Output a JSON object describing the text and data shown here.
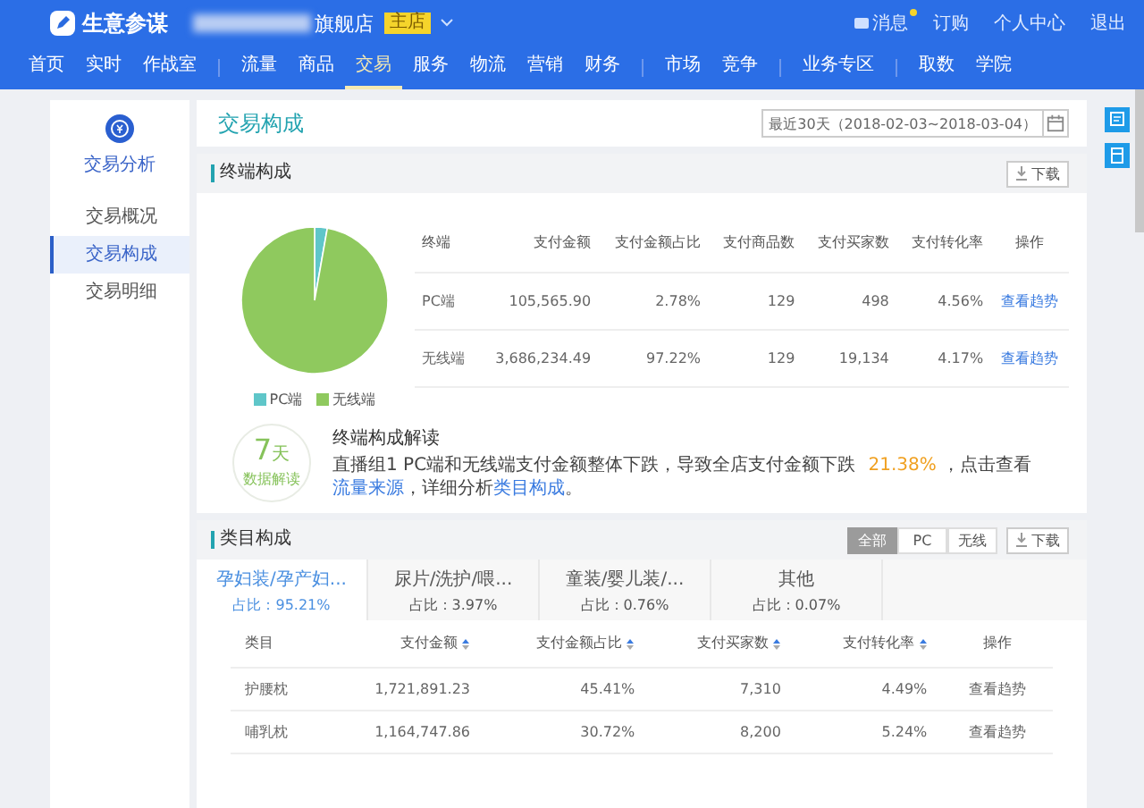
{
  "header": {
    "logo_text": "生意参谋",
    "store_suffix": "旗舰店",
    "badge": "主店",
    "links": [
      {
        "label": "消息",
        "dot": true
      },
      {
        "label": "订购",
        "dot": false
      },
      {
        "label": "个人中心",
        "dot": false
      },
      {
        "label": "退出",
        "dot": false
      }
    ],
    "nav_groups": [
      [
        {
          "label": "首页",
          "selected": false
        },
        {
          "label": "实时",
          "selected": false
        },
        {
          "label": "作战室",
          "selected": false
        }
      ],
      [
        {
          "label": "流量",
          "selected": false
        },
        {
          "label": "商品",
          "selected": false
        },
        {
          "label": "交易",
          "selected": true
        },
        {
          "label": "服务",
          "selected": false
        },
        {
          "label": "物流",
          "selected": false
        },
        {
          "label": "营销",
          "selected": false
        },
        {
          "label": "财务",
          "selected": false
        }
      ],
      [
        {
          "label": "市场",
          "selected": false
        },
        {
          "label": "竞争",
          "selected": false
        }
      ],
      [
        {
          "label": "业务专区",
          "selected": false
        }
      ],
      [
        {
          "label": "取数",
          "selected": false
        },
        {
          "label": "学院",
          "selected": false
        }
      ]
    ]
  },
  "sidebar": {
    "title": "交易分析",
    "items": [
      {
        "label": "交易概况",
        "selected": false
      },
      {
        "label": "交易构成",
        "selected": true
      },
      {
        "label": "交易明细",
        "selected": false
      }
    ]
  },
  "page": {
    "title": "交易构成",
    "date_range": "最近30天（2018-02-03~2018-03-04）"
  },
  "terminal": {
    "title": "终端构成",
    "download": "下载",
    "chart_data": {
      "type": "pie",
      "categories": [
        "PC端",
        "无线端"
      ],
      "values": [
        2.78,
        97.22
      ],
      "legend": "bottom"
    },
    "columns": [
      "终端",
      "支付金额",
      "支付金额占比",
      "支付商品数",
      "支付买家数",
      "支付转化率",
      "操作"
    ],
    "rows": [
      [
        "PC端",
        "105,565.90",
        "2.78%",
        "129",
        "498",
        "4.56%",
        "查看趋势"
      ],
      [
        "无线端",
        "3,686,234.49",
        "97.22%",
        "129",
        "19,134",
        "4.17%",
        "查看趋势"
      ]
    ],
    "insight": {
      "badge_number": "7",
      "badge_unit": "天",
      "badge_label": "数据解读",
      "title": "终端构成解读",
      "segments": [
        {
          "kind": "text",
          "text": "直播组1 PC端和无线端支付金额整体下跌，导致全店支付金额下跌 "
        },
        {
          "kind": "highlight",
          "text": "21.38%"
        },
        {
          "kind": "text",
          "text": " ，点击查看"
        },
        {
          "kind": "link",
          "text": "流量来源"
        },
        {
          "kind": "text",
          "text": "，详细分析"
        },
        {
          "kind": "link",
          "text": "类目构成"
        },
        {
          "kind": "text",
          "text": "。"
        }
      ]
    }
  },
  "category": {
    "title": "类目构成",
    "download": "下载",
    "filters": [
      {
        "label": "全部",
        "selected": true
      },
      {
        "label": "PC",
        "selected": false
      },
      {
        "label": "无线",
        "selected": false
      }
    ],
    "tabs": [
      {
        "label": "孕妇装/孕产妇...",
        "share": "占比：95.21%",
        "selected": true
      },
      {
        "label": "尿片/洗护/喂...",
        "share": "占比：3.97%",
        "selected": false
      },
      {
        "label": "童装/婴儿装/...",
        "share": "占比：0.76%",
        "selected": false
      },
      {
        "label": "其他",
        "share": "占比：0.07%",
        "selected": false
      }
    ],
    "columns": [
      {
        "label": "类目",
        "sortable": false
      },
      {
        "label": "支付金额",
        "sortable": true
      },
      {
        "label": "支付金额占比",
        "sortable": true
      },
      {
        "label": "支付买家数",
        "sortable": true
      },
      {
        "label": "支付转化率",
        "sortable": true
      },
      {
        "label": "操作",
        "sortable": false
      }
    ],
    "rows": [
      [
        "护腰枕",
        "1,721,891.23",
        "45.41%",
        "7,310",
        "4.49%",
        "查看趋势"
      ],
      [
        "哺乳枕",
        "1,164,747.86",
        "30.72%",
        "8,200",
        "5.24%",
        "查看趋势"
      ]
    ]
  }
}
